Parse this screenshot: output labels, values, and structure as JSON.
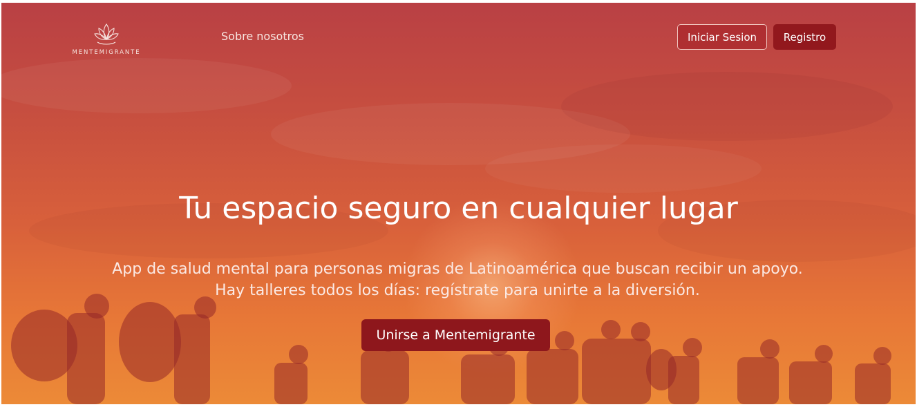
{
  "nav": {
    "logo_text": "MENTEMIGRANTE",
    "about_link": "Sobre nosotros",
    "login_button": "Iniciar Sesion",
    "register_button": "Registro"
  },
  "hero": {
    "headline": "Tu espacio seguro en cualquier lugar",
    "subtitle": "App de salud mental para personas migras de Latinoamérica que buscan recibir un apoyo. Hay talleres todos los días: regístrate para unirte a la diversión.",
    "cta_button": "Unirse a Mentemigrante"
  },
  "colors": {
    "primary_button": "#92181d",
    "sky_top": "#b94044",
    "sky_bottom": "#ec8a37"
  },
  "icons": {
    "logo": "lotus-icon"
  }
}
